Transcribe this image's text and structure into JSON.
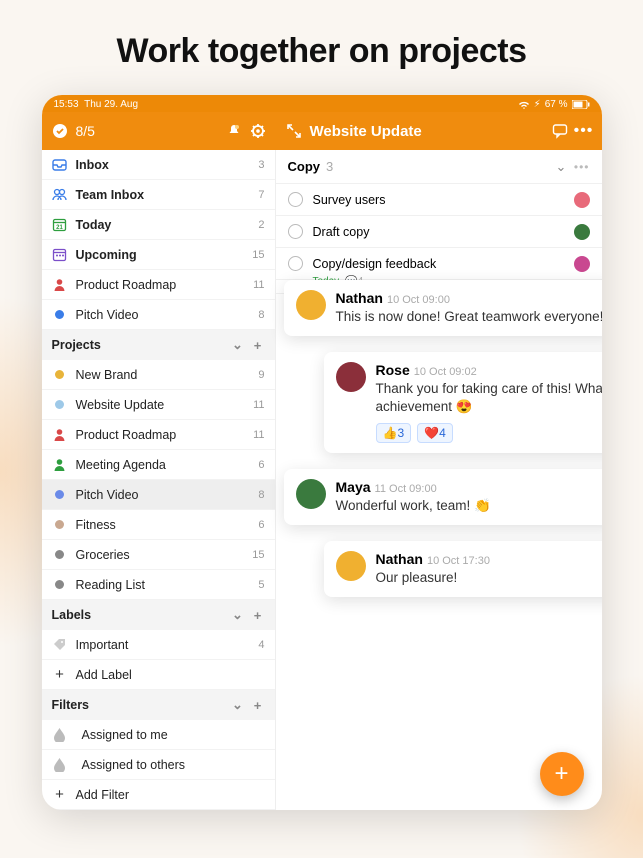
{
  "headline": "Work together on projects",
  "status": {
    "time": "15:53",
    "date": "Thu 29. Aug",
    "battery": "67 %"
  },
  "header": {
    "left_counter": "8/5",
    "project_title": "Website Update"
  },
  "nav": [
    {
      "icon": "inbox",
      "label": "Inbox",
      "count": 3,
      "bold": true,
      "color": "#3a7de8"
    },
    {
      "icon": "team-inbox",
      "label": "Team Inbox",
      "count": 7,
      "bold": true,
      "color": "#3a7de8"
    },
    {
      "icon": "calendar",
      "label": "Today",
      "count": 2,
      "bold": true,
      "color": "#2e9e3f"
    },
    {
      "icon": "upcoming",
      "label": "Upcoming",
      "count": 15,
      "bold": true,
      "color": "#7b4fc9"
    },
    {
      "icon": "person",
      "label": "Product Roadmap",
      "count": 11,
      "bold": false,
      "color": "#d94848"
    },
    {
      "icon": "dot",
      "label": "Pitch Video",
      "count": 8,
      "bold": false,
      "color": "#3a7de8"
    }
  ],
  "projects": {
    "title": "Projects",
    "items": [
      {
        "label": "New Brand",
        "count": 9,
        "color": "#e8b43a"
      },
      {
        "label": "Website Update",
        "count": 11,
        "color": "#9ec9e8"
      },
      {
        "label": "Product Roadmap",
        "count": 11,
        "color": "#d94848",
        "icon": "person"
      },
      {
        "label": "Meeting Agenda",
        "count": 6,
        "color": "#2e9e3f",
        "icon": "person"
      },
      {
        "label": "Pitch Video",
        "count": 8,
        "color": "#6a8ae8",
        "active": true
      },
      {
        "label": "Fitness",
        "count": 6,
        "color": "#c9a890"
      },
      {
        "label": "Groceries",
        "count": 15,
        "color": "#888"
      },
      {
        "label": "Reading List",
        "count": 5,
        "color": "#888"
      }
    ]
  },
  "labels": {
    "title": "Labels",
    "items": [
      {
        "label": "Important",
        "count": 4,
        "icon": "tag"
      }
    ],
    "add": "Add Label"
  },
  "filters": {
    "title": "Filters",
    "items": [
      {
        "label": "Assigned to me",
        "icon": "drop"
      },
      {
        "label": "Assigned to others",
        "icon": "drop"
      }
    ],
    "add": "Add Filter"
  },
  "task_section": {
    "name": "Copy",
    "count": 3,
    "tasks": [
      {
        "title": "Survey users",
        "avatar": "#e86a7a"
      },
      {
        "title": "Draft copy",
        "avatar": "#3a7a3e"
      },
      {
        "title": "Copy/design feedback",
        "avatar": "#c94890",
        "meta": {
          "date": "Today",
          "comments": "4"
        }
      }
    ]
  },
  "comments": [
    {
      "name": "Nathan",
      "time": "10 Oct 09:00",
      "text": "This is now done! Great teamwork everyone!",
      "avatar_bg": "#f0b030",
      "side": "left"
    },
    {
      "name": "Rose",
      "time": "10 Oct 09:02",
      "text": "Thank you for taking care of this! What an achievement 😍",
      "avatar_bg": "#8b2f3a",
      "side": "right",
      "reactions": [
        {
          "emoji": "👍",
          "count": 3
        },
        {
          "emoji": "❤️",
          "count": 4
        }
      ]
    },
    {
      "name": "Maya",
      "time": "11 Oct 09:00",
      "text": "Wonderful work, team! 👏",
      "avatar_bg": "#3a7a3e",
      "side": "left"
    },
    {
      "name": "Nathan",
      "time": "10 Oct 17:30",
      "text": "Our pleasure!",
      "avatar_bg": "#f0b030",
      "side": "right"
    }
  ]
}
